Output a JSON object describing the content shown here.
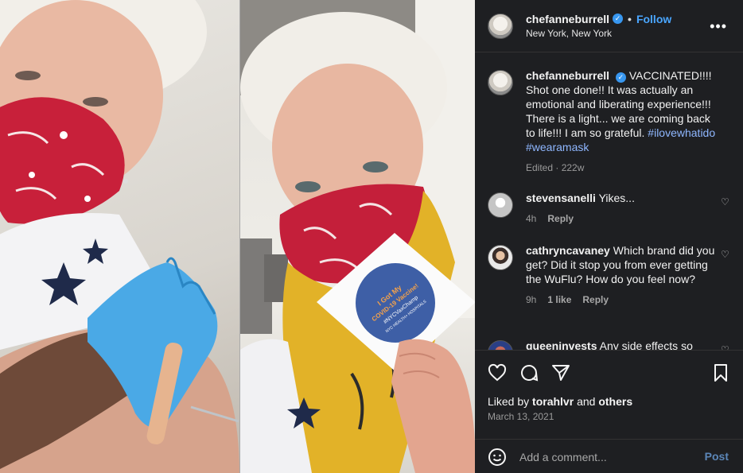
{
  "header": {
    "username": "chefanneburrell",
    "verified": true,
    "separator": "•",
    "follow_label": "Follow",
    "location": "New York, New York",
    "more_label": "•••"
  },
  "caption": {
    "username": "chefanneburrell",
    "text": "VACCINATED!!!! Shot one done!! It was actually an emotional and liberating experience!!! There is a light... we are coming back to life!!! I am so grateful.",
    "hashtags": [
      "#ilovewhatido",
      "#wearamask"
    ],
    "meta": "Edited · 222w"
  },
  "comments": [
    {
      "username": "stevensanelli",
      "text": "Yikes...",
      "time": "4h",
      "likes": "",
      "reply": "Reply"
    },
    {
      "username": "cathryncavaney",
      "text": "Which brand did you get? Did it stop you from ever getting the WuFlu? How do you feel now?",
      "time": "9h",
      "likes": "1 like",
      "reply": "Reply"
    },
    {
      "username": "queeninvests",
      "text": "Any side effects so",
      "time": "",
      "likes": "",
      "reply": ""
    }
  ],
  "actions": {
    "liked_prefix": "Liked by",
    "liked_user": "torahlvr",
    "liked_and": "and",
    "liked_others": "others",
    "date": "March 13, 2021"
  },
  "add_comment": {
    "placeholder": "Add a comment...",
    "post_label": "Post"
  },
  "media": {
    "photos": [
      "vaccination-shoulder-photo",
      "vaccine-sticker-selfie-photo"
    ]
  },
  "sticker": {
    "line1": "I Got My",
    "line2": "COVID-19 Vaccine!",
    "line3": "#NYCVaxChamp",
    "line4": "NYC HEALTH+ HOSPITALS"
  },
  "colors": {
    "panel_bg": "#1e1f22",
    "accent_blue": "#4aa6ff",
    "hashtag": "#8fb7ff",
    "muted": "#9a9a9a"
  }
}
